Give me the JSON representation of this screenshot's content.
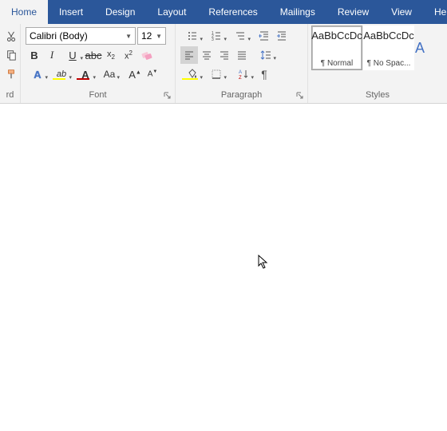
{
  "tabs": [
    "Home",
    "Insert",
    "Design",
    "Layout",
    "References",
    "Mailings",
    "Review",
    "View",
    "Hel"
  ],
  "activeTab": 0,
  "font": {
    "family": "Calibri (Body)",
    "size": "12"
  },
  "groups": {
    "clipboard": "rd",
    "font": "Font",
    "paragraph": "Paragraph",
    "styles": "Styles"
  },
  "styles": [
    {
      "preview": "AaBbCcDc",
      "name": "¶ Normal",
      "selected": true
    },
    {
      "preview": "AaBbCcDc",
      "name": "¶ No Spac...",
      "selected": false
    }
  ],
  "stylesPartial": "A",
  "colors": {
    "highlight": "#ffff00",
    "fontColor": "#c00000",
    "shading": "#ffff00",
    "accent": "#4472c4"
  }
}
